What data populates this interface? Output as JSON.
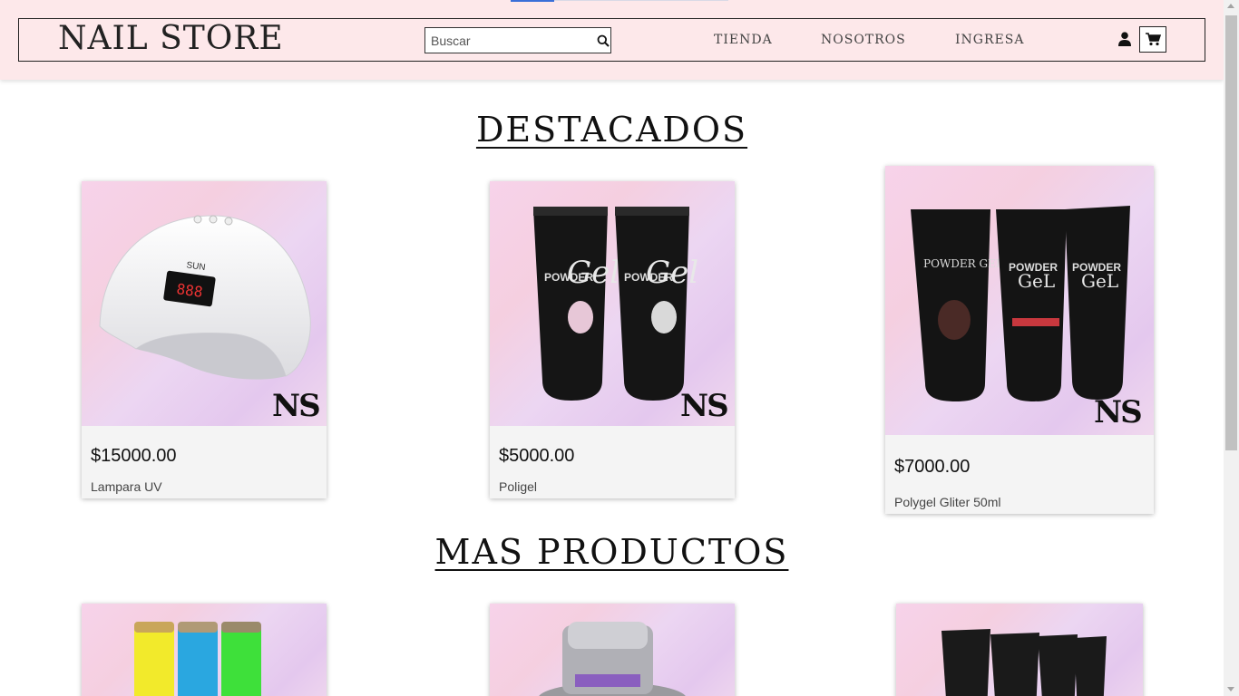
{
  "header": {
    "logo": "NAIL STORE",
    "search_placeholder": "Buscar",
    "nav": [
      "TIENDA",
      "NOSOTROS",
      "INGRESA"
    ],
    "user_icon": "user-icon",
    "cart_icon": "cart-icon",
    "search_icon": "search-icon"
  },
  "sections": {
    "featured_title": "DESTACADOS",
    "more_title": "MAS PRODUCTOS"
  },
  "featured_products": [
    {
      "price": "$15000.00",
      "name": "Lampara UV"
    },
    {
      "price": "$5000.00",
      "name": "Poligel"
    },
    {
      "price": "$7000.00",
      "name": "Polygel Gliter 50ml"
    }
  ],
  "colors": {
    "header_bg": "#fde8ea",
    "card_bg": "#f4f4f4"
  }
}
